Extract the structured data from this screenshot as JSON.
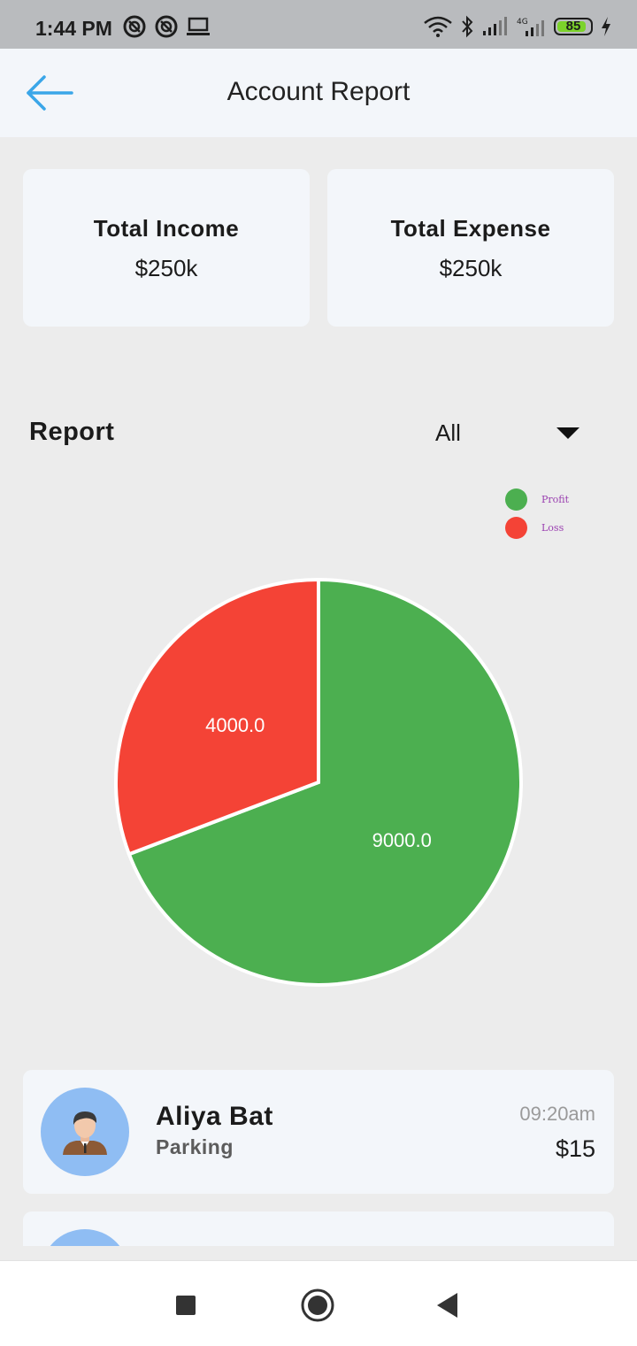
{
  "status_bar": {
    "time": "1:44 PM",
    "battery_level": "85",
    "battery_percent": 85,
    "icons": [
      "sync-icon",
      "sync-icon",
      "laptop-icon",
      "wifi-icon",
      "bluetooth-icon",
      "signal-icon",
      "4g-signal-icon",
      "battery-icon",
      "charging-icon"
    ]
  },
  "app_bar": {
    "title": "Account Report",
    "back_icon": "arrow-left-icon",
    "accent_color": "#3aa6e8"
  },
  "summary": {
    "income": {
      "label": "Total Income",
      "value": "$250k"
    },
    "expense": {
      "label": "Total Expense",
      "value": "$250k"
    }
  },
  "report": {
    "title": "Report",
    "filter": {
      "selected": "All"
    }
  },
  "chart_data": {
    "type": "pie",
    "categories": [
      "Profit",
      "Loss"
    ],
    "values": [
      9000.0,
      4000.0
    ],
    "data_labels": [
      "9000.0",
      "4000.0"
    ],
    "colors": [
      "#4caf50",
      "#f44336"
    ],
    "legend": [
      {
        "label": "Profit",
        "color": "#4caf50"
      },
      {
        "label": "Loss",
        "color": "#f44336"
      }
    ],
    "legend_position": "top-right"
  },
  "transactions": [
    {
      "name": "Aliya Bat",
      "category": "Parking",
      "time": "09:20am",
      "amount": "$15"
    },
    {
      "name": "",
      "category": "",
      "time": "",
      "amount": ""
    }
  ],
  "nav_bar": {
    "buttons": [
      "recents-square-icon",
      "home-circle-icon",
      "back-triangle-icon"
    ]
  }
}
